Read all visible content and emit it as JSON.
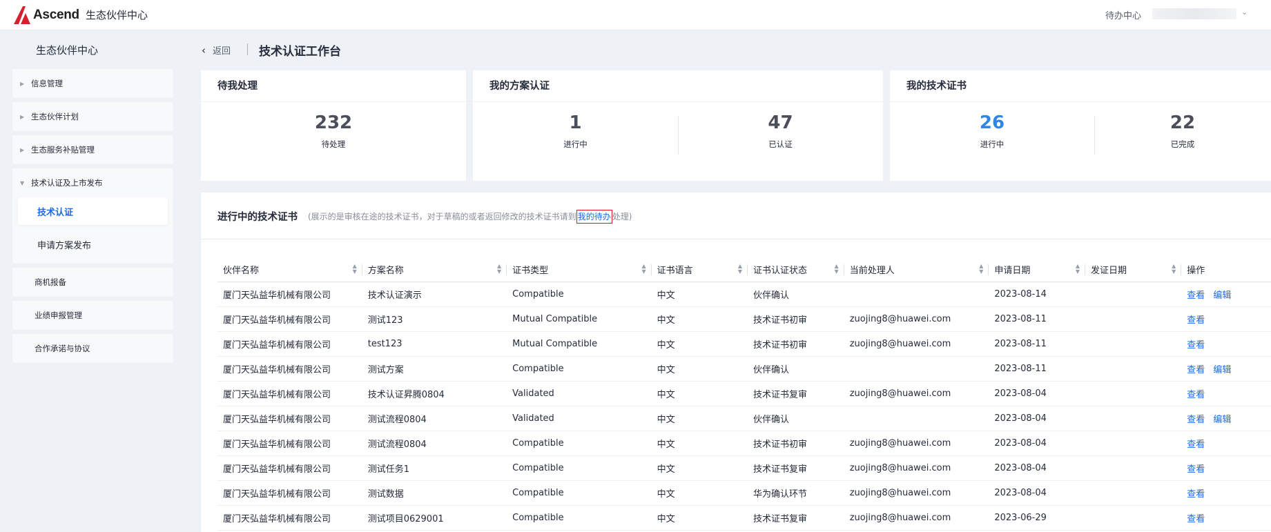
{
  "topbar": {
    "brand": "Ascend",
    "site_title": "生态伙伴中心",
    "todo_center": "待办中心"
  },
  "sidebar": {
    "title": "生态伙伴中心",
    "items": [
      {
        "label": "信息管理"
      },
      {
        "label": "生态伙伴计划"
      },
      {
        "label": "生态服务补贴管理"
      },
      {
        "label": "技术认证及上市发布",
        "children": [
          {
            "label": "技术认证"
          },
          {
            "label": "申请方案发布"
          }
        ]
      },
      {
        "label": "商机报备"
      },
      {
        "label": "业绩申报管理"
      },
      {
        "label": "合作承诺与协议"
      }
    ]
  },
  "header": {
    "back": "返回",
    "title": "技术认证工作台"
  },
  "cards": {
    "pending": {
      "title": "待我处理",
      "value": "232",
      "caption": "待处理"
    },
    "solution": {
      "title": "我的方案认证",
      "in_progress": "1",
      "in_progress_label": "进行中",
      "certified": "47",
      "certified_label": "已认证"
    },
    "tech_cert": {
      "title": "我的技术证书",
      "in_progress": "26",
      "in_progress_label": "进行中",
      "completed": "22",
      "completed_label": "已完成"
    }
  },
  "panel": {
    "title": "进行中的技术证书",
    "note_prefix": "(展示的是审核在途的技术证书，对于草稿的或者返回修改的技术证书请到",
    "note_link": "我的待办",
    "note_suffix": "处理)",
    "columns": [
      "伙伴名称",
      "方案名称",
      "证书类型",
      "证书语言",
      "证书认证状态",
      "当前处理人",
      "申请日期",
      "发证日期",
      "操作"
    ],
    "view_label": "查看",
    "edit_label": "编辑",
    "rows": [
      {
        "partner": "厦门天弘益华机械有限公司",
        "solution": "技术认证演示",
        "type": "Compatible",
        "lang": "中文",
        "status": "伙伴确认",
        "handler": "",
        "apply_date": "2023-08-14",
        "issue_date": "",
        "edit": true
      },
      {
        "partner": "厦门天弘益华机械有限公司",
        "solution": "测试123",
        "type": "Mutual Compatible",
        "lang": "中文",
        "status": "技术证书初审",
        "handler": "zuojing8@huawei.com",
        "apply_date": "2023-08-11",
        "issue_date": "",
        "edit": false
      },
      {
        "partner": "厦门天弘益华机械有限公司",
        "solution": "test123",
        "type": "Mutual Compatible",
        "lang": "中文",
        "status": "技术证书初审",
        "handler": "zuojing8@huawei.com",
        "apply_date": "2023-08-11",
        "issue_date": "",
        "edit": false
      },
      {
        "partner": "厦门天弘益华机械有限公司",
        "solution": "测试方案",
        "type": "Compatible",
        "lang": "中文",
        "status": "伙伴确认",
        "handler": "",
        "apply_date": "2023-08-11",
        "issue_date": "",
        "edit": true
      },
      {
        "partner": "厦门天弘益华机械有限公司",
        "solution": "技术认证昇腾0804",
        "type": "Validated",
        "lang": "中文",
        "status": "技术证书复审",
        "handler": "zuojing8@huawei.com",
        "apply_date": "2023-08-04",
        "issue_date": "",
        "edit": false
      },
      {
        "partner": "厦门天弘益华机械有限公司",
        "solution": "测试流程0804",
        "type": "Validated",
        "lang": "中文",
        "status": "伙伴确认",
        "handler": "",
        "apply_date": "2023-08-04",
        "issue_date": "",
        "edit": true
      },
      {
        "partner": "厦门天弘益华机械有限公司",
        "solution": "测试流程0804",
        "type": "Compatible",
        "lang": "中文",
        "status": "技术证书初审",
        "handler": "zuojing8@huawei.com",
        "apply_date": "2023-08-04",
        "issue_date": "",
        "edit": false
      },
      {
        "partner": "厦门天弘益华机械有限公司",
        "solution": "测试任务1",
        "type": "Compatible",
        "lang": "中文",
        "status": "技术证书复审",
        "handler": "zuojing8@huawei.com",
        "apply_date": "2023-08-04",
        "issue_date": "",
        "edit": false
      },
      {
        "partner": "厦门天弘益华机械有限公司",
        "solution": "测试数据",
        "type": "Compatible",
        "lang": "中文",
        "status": "华为确认环节",
        "handler": "zuojing8@huawei.com",
        "apply_date": "2023-08-04",
        "issue_date": "",
        "edit": false
      },
      {
        "partner": "厦门天弘益华机械有限公司",
        "solution": "测试项目0629001",
        "type": "Compatible",
        "lang": "中文",
        "status": "技术证书复审",
        "handler": "zuojing8@huawei.com",
        "apply_date": "2023-06-29",
        "issue_date": "",
        "edit": false
      }
    ]
  }
}
